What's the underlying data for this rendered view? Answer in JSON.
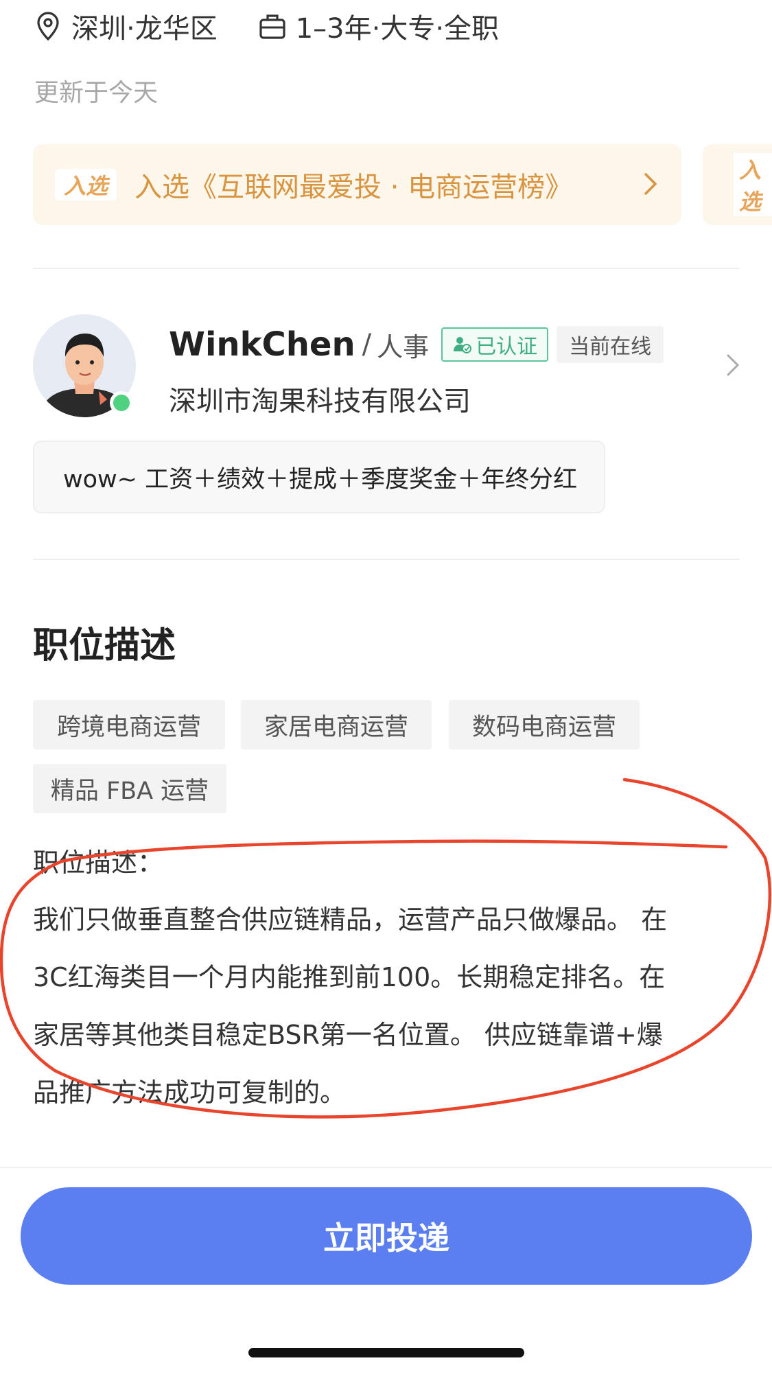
{
  "job_meta": {
    "location": "深圳·龙华区",
    "requirements": "1–3年·大专·全职",
    "updated": "更新于今天"
  },
  "banner": {
    "badge": "入选",
    "text": "入选《互联网最爱投 · 电商运营榜》",
    "peek_badge": "入选"
  },
  "recruiter": {
    "name": "WinkChen",
    "separator": "/",
    "role": "人事",
    "verified_label": "已认证",
    "online_label": "当前在线",
    "company": "深圳市淘果科技有限公司",
    "greeting": "wow~ 工资＋绩效＋提成＋季度奖金＋年终分红"
  },
  "section": {
    "title": "职位描述",
    "tags": [
      "跨境电商运营",
      "家居电商运营",
      "数码电商运营",
      "精品 FBA 运营"
    ],
    "description_heading": "职位描述：",
    "description_lines": [
      "我们只做垂直整合供应链精品，运营产品只做爆品。 在",
      "3C红海类目一个月内能推到前100。长期稳定排名。在",
      "家居等其他类目稳定BSR第一名位置。 供应链靠谱+爆",
      "品推广方法成功可复制的。"
    ]
  },
  "actions": {
    "apply_label": "立即投递"
  },
  "colors": {
    "primary_button": "#5b7ff1",
    "banner_bg": "#fdf6ea",
    "banner_text": "#d8943f",
    "verified_green": "#3fae83",
    "online_dot": "#4fd17f",
    "annotation_red": "#e8452c"
  },
  "icons": {
    "location": "location-pin-icon",
    "job": "briefcase-icon",
    "banner_arrow": "chevron-right-icon",
    "verified": "verified-user-icon"
  }
}
